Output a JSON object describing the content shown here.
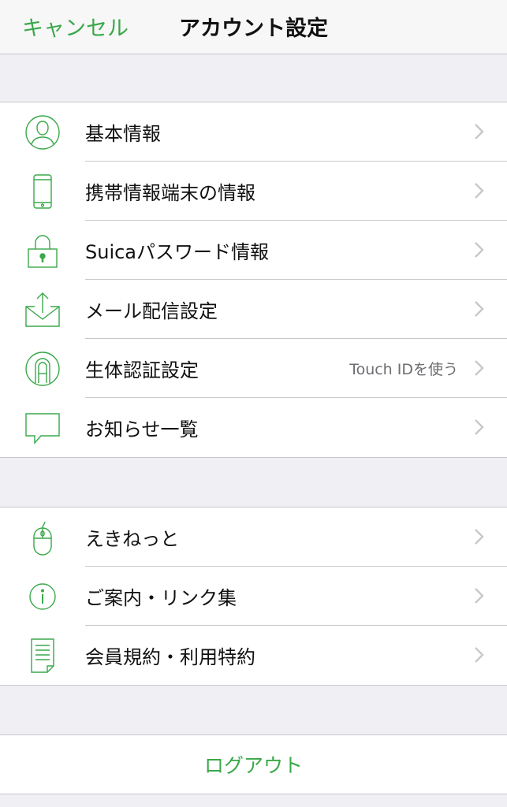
{
  "navbar": {
    "cancel_label": "キャンセル",
    "title": "アカウント設定"
  },
  "accent_color": "#3aa84a",
  "group1": {
    "items": [
      {
        "label": "基本情報",
        "icon": "person-icon"
      },
      {
        "label": "携帯情報端末の情報",
        "icon": "smartphone-icon"
      },
      {
        "label": "Suicaパスワード情報",
        "icon": "lock-icon"
      },
      {
        "label": "メール配信設定",
        "icon": "mail-icon"
      },
      {
        "label": "生体認証設定",
        "icon": "fingerprint-icon",
        "detail": "Touch IDを使う"
      },
      {
        "label": "お知らせ一覧",
        "icon": "speech-bubble-icon"
      }
    ]
  },
  "group2": {
    "items": [
      {
        "label": "えきねっと",
        "icon": "mouse-icon"
      },
      {
        "label": "ご案内・リンク集",
        "icon": "info-icon"
      },
      {
        "label": "会員規約・利用特約",
        "icon": "document-icon"
      }
    ]
  },
  "logout": {
    "label": "ログアウト"
  }
}
